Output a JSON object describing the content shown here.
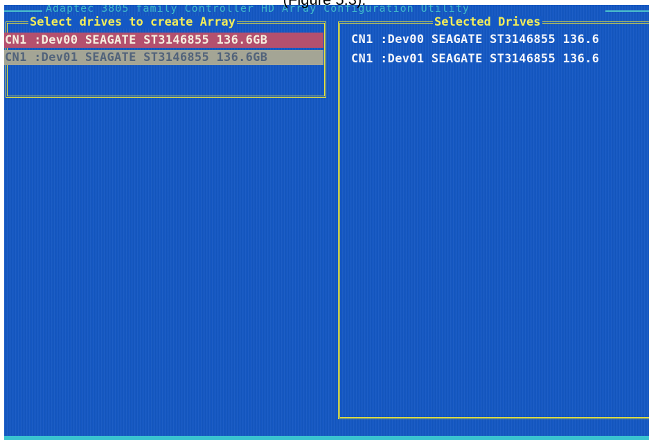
{
  "caption": "(Figure 5.3).",
  "title_bar": {
    "title": "Adaptec 3805 family Controller HD Array Configuration Utility"
  },
  "left_panel": {
    "title": "Select drives to create Array",
    "drives": [
      {
        "label": "CN1 :Dev00  SEAGATE ST3146855 136.6GB",
        "state": "highlighted"
      },
      {
        "label": "CN1 :Dev01  SEAGATE ST3146855 136.6GB",
        "state": "selected"
      }
    ]
  },
  "right_panel": {
    "title": "Selected Drives",
    "drives": [
      {
        "label": "CN1  :Dev00 SEAGATE ST3146855 136.6"
      },
      {
        "label": "CN1  :Dev01 SEAGATE ST3146855 136.6"
      }
    ]
  },
  "colors": {
    "screen_background": "#1458c4",
    "frame": "#e8e23a",
    "highlight_row": "#b4506e",
    "selected_row": "#a4a595",
    "title_bar_text": "#3fb9c9"
  }
}
